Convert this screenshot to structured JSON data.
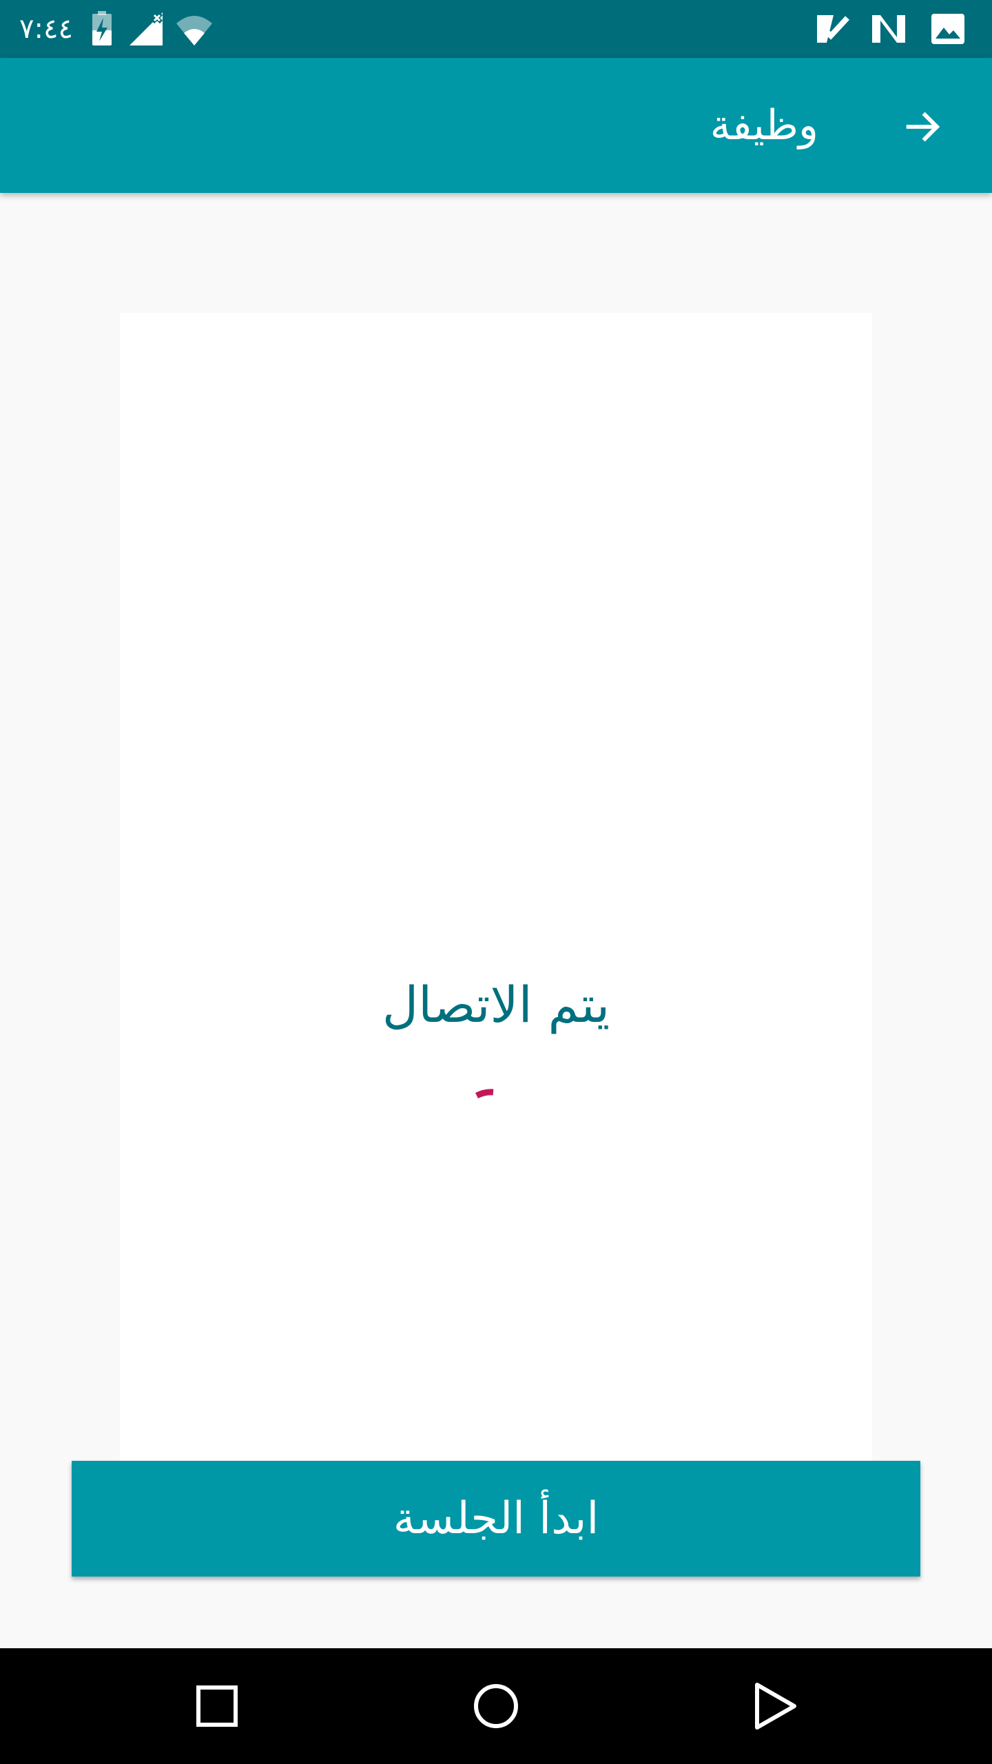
{
  "status_bar": {
    "time": "٧:٤٤",
    "icons": [
      "battery-charging-icon",
      "signal-off-icon",
      "wifi-icon",
      "task-check-icon",
      "n-logo-icon",
      "image-icon"
    ]
  },
  "app_bar": {
    "title": "وظيفة",
    "back_icon": "arrow-right-icon"
  },
  "main": {
    "status_text": "يتم الاتصال",
    "spinner_color": "#c2185b",
    "start_button_label": "ابدأ الجلسة"
  },
  "colors": {
    "status_bar": "#006d7b",
    "app_bar": "#0097a7",
    "text_accent": "#00707e",
    "background": "#f9f9f9"
  },
  "nav_bar": {
    "buttons": [
      "recents-square-icon",
      "home-circle-icon",
      "back-triangle-icon"
    ]
  }
}
